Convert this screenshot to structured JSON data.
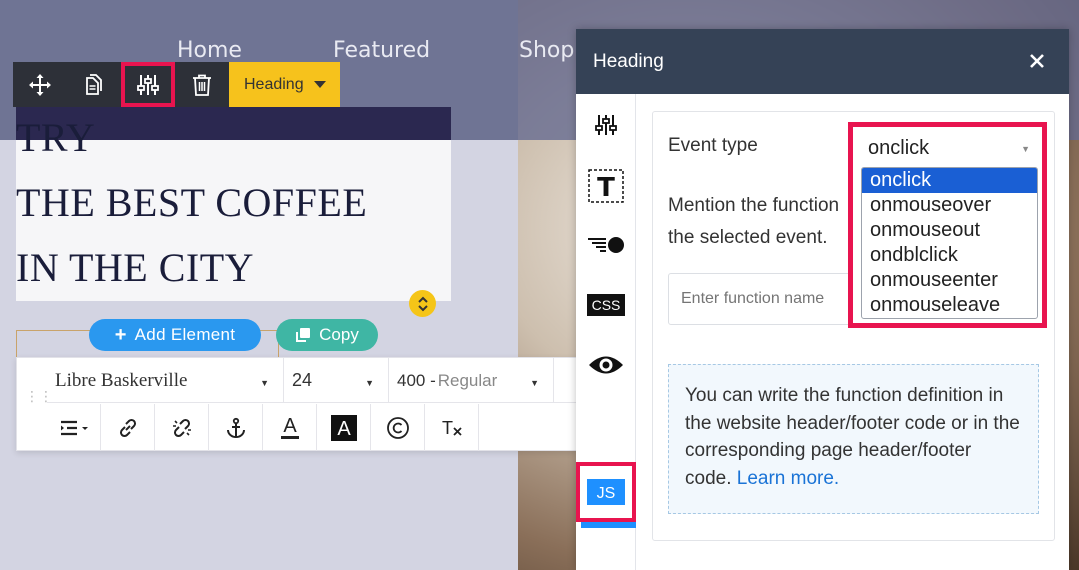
{
  "site": {
    "nav": [
      "Home",
      "Featured",
      "Shop"
    ],
    "heading_lines": [
      "TRY",
      "THE BEST COFFEE",
      "IN THE CITY"
    ],
    "add_element_label": "Add Element",
    "copy_label": "Copy"
  },
  "element_toolbar": {
    "element_type": "Heading",
    "icons": [
      "move-icon",
      "duplicate-icon",
      "settings-sliders-icon",
      "delete-icon"
    ]
  },
  "format_toolbar": {
    "font_family": "Libre Baskerville",
    "font_size": "24",
    "font_weight_num": "400 -",
    "font_weight_name": "Regular"
  },
  "panel": {
    "title": "Heading",
    "event_type_label": "Event type",
    "event_selected": "onclick",
    "event_options": [
      "onclick",
      "onmouseover",
      "onmouseout",
      "ondblclick",
      "onmouseenter",
      "onmouseleave"
    ],
    "mention_line1": "Mention the function",
    "mention_line2": "the selected event.",
    "function_placeholder": "Enter function name",
    "info_text": "You can write the function definition in the website header/footer code or in the corresponding page header/footer code.",
    "learn_more": "Learn more.",
    "side_icons": [
      "settings-sliders-icon",
      "text-style-icon",
      "animation-icon",
      "css-icon",
      "visibility-icon",
      "javascript-icon"
    ],
    "side_css_label": "CSS",
    "side_js_label": "JS"
  },
  "colors": {
    "highlight": "#e8144f",
    "panel_header": "#354256",
    "primary": "#2a98ef",
    "toolbar_yellow": "#f6c21c",
    "copy_teal": "#3fb6a4"
  }
}
